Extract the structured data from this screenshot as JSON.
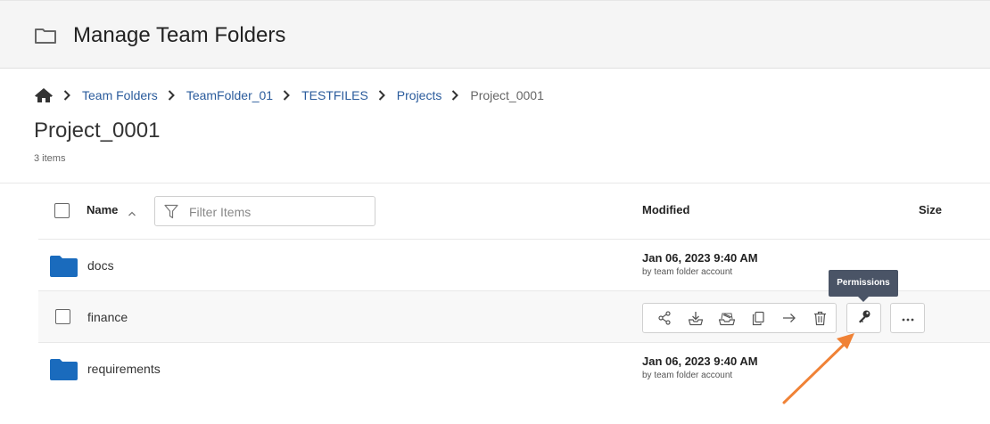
{
  "header": {
    "title": "Manage Team Folders"
  },
  "breadcrumb": {
    "items": [
      "Team Folders",
      "TeamFolder_01",
      "TESTFILES",
      "Projects",
      "Project_0001"
    ]
  },
  "folder": {
    "title": "Project_0001",
    "count_label": "3 items"
  },
  "table": {
    "columns": {
      "name": "Name",
      "modified": "Modified",
      "size": "Size"
    },
    "filter_placeholder": "Filter Items",
    "rows": [
      {
        "name": "docs",
        "modified_date": "Jan 06, 2023 9:40 AM",
        "modified_by": "by team folder account"
      },
      {
        "name": "finance"
      },
      {
        "name": "requirements",
        "modified_date": "Jan 06, 2023 9:40 AM",
        "modified_by": "by team folder account"
      }
    ]
  },
  "tooltip": {
    "text": "Permissions"
  },
  "icons": {
    "header": "folder-outline-icon",
    "breadcrumb_home": "home-icon",
    "actions": [
      "share-icon",
      "download-icon",
      "upload-icon",
      "copy-icon",
      "move-arrow-icon",
      "trash-icon",
      "key-icon",
      "more-icon"
    ]
  },
  "colors": {
    "folder_blue": "#1a6bbd",
    "link_blue": "#2a5b9c",
    "annotation_orange": "#f08236",
    "tooltip_bg": "#4a5466"
  }
}
